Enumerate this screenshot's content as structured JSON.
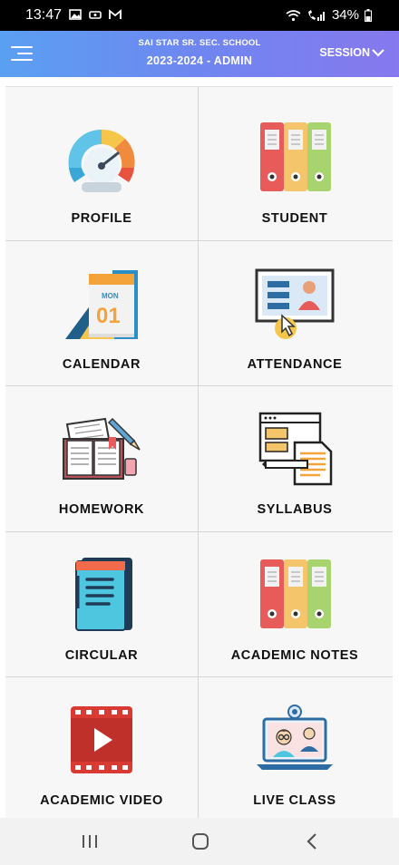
{
  "status": {
    "time": "13:47",
    "battery": "34%"
  },
  "header": {
    "school": "SAI STAR SR. SEC. SCHOOL",
    "year_role": "2023-2024 - ADMIN",
    "session_label": "SESSION"
  },
  "tiles": [
    {
      "label": "PROFILE",
      "icon": "speedometer-icon"
    },
    {
      "label": "STUDENT",
      "icon": "binders-icon"
    },
    {
      "label": "CALENDAR",
      "icon": "calendar-icon",
      "calendar_day": "MON",
      "calendar_date": "01"
    },
    {
      "label": "ATTENDANCE",
      "icon": "attendance-board-icon"
    },
    {
      "label": "HOMEWORK",
      "icon": "notebook-pencil-icon"
    },
    {
      "label": "SYLLABUS",
      "icon": "syllabus-document-icon"
    },
    {
      "label": "CIRCULAR",
      "icon": "circular-notepad-icon"
    },
    {
      "label": "ACADEMIC NOTES",
      "icon": "binders-icon"
    },
    {
      "label": "ACADEMIC VIDEO",
      "icon": "video-film-icon"
    },
    {
      "label": "LIVE CLASS",
      "icon": "live-class-laptop-icon"
    }
  ],
  "colors": {
    "appbar_start": "#5aa0f2",
    "appbar_end": "#8678ee",
    "red": "#e85b5b",
    "yellow": "#f5c56b",
    "green": "#a8d46f"
  }
}
